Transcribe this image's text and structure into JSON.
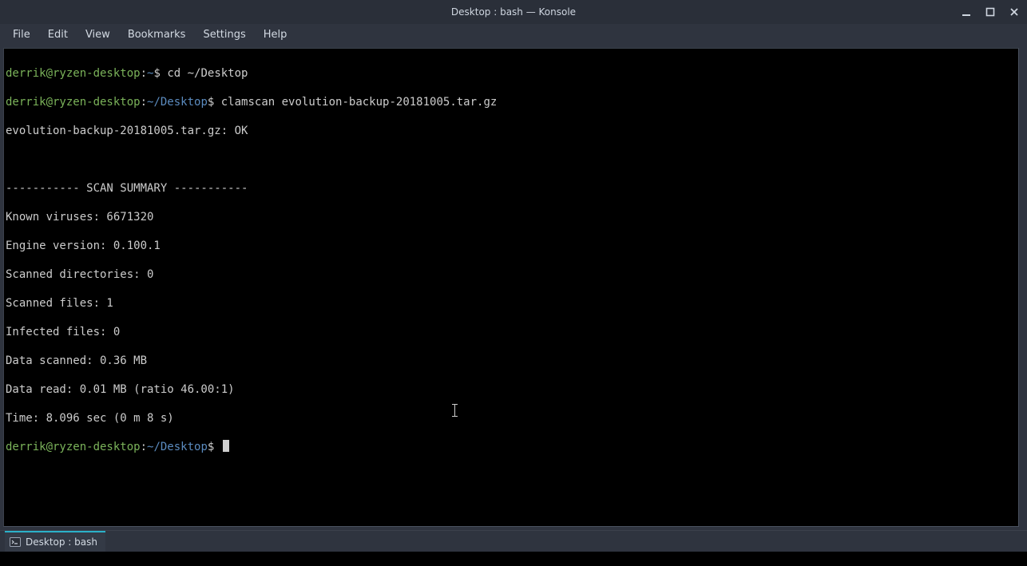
{
  "title": "Desktop : bash — Konsole",
  "menu": {
    "file": "File",
    "edit": "Edit",
    "view": "View",
    "bookmarks": "Bookmarks",
    "settings": "Settings",
    "help": "Help"
  },
  "prompt": {
    "user_host": "derrik@ryzen-desktop",
    "sep": ":",
    "home": "~",
    "path": "~/Desktop",
    "symbol": "$"
  },
  "commands": {
    "cd": "cd ~/Desktop",
    "scan": "clamscan evolution-backup-20181005.tar.gz"
  },
  "output": {
    "result_line": "evolution-backup-20181005.tar.gz: OK",
    "blank": "",
    "summary_header": "----------- SCAN SUMMARY -----------",
    "known_viruses": "Known viruses: 6671320",
    "engine_version": "Engine version: 0.100.1",
    "scanned_dirs": "Scanned directories: 0",
    "scanned_files": "Scanned files: 1",
    "infected_files": "Infected files: 0",
    "data_scanned": "Data scanned: 0.36 MB",
    "data_read": "Data read: 0.01 MB (ratio 46.00:1)",
    "time": "Time: 8.096 sec (0 m 8 s)"
  },
  "tab": {
    "label": "Desktop : bash"
  }
}
